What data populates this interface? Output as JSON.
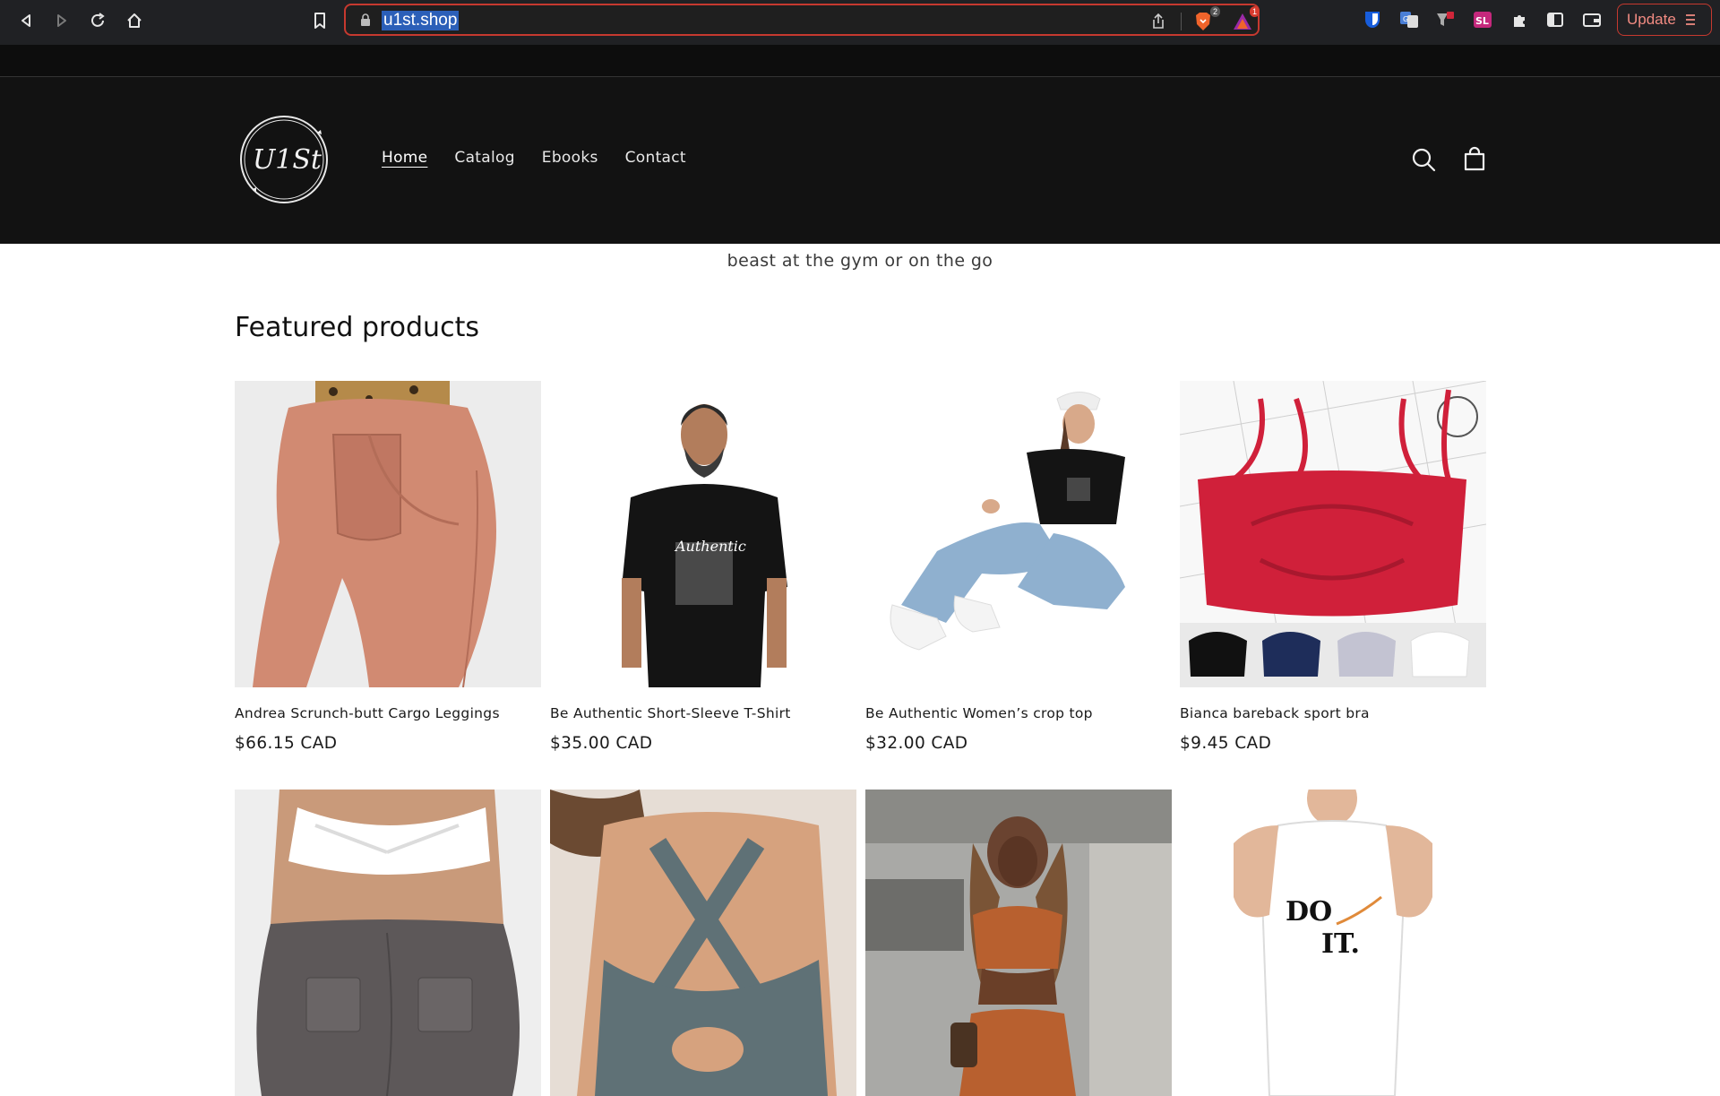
{
  "browser": {
    "url": "u1st.shop",
    "shields_badge": "2",
    "alert_badge": "1",
    "update_label": "Update",
    "accent_color": "#c6392f"
  },
  "store": {
    "logo_text": "U1St",
    "nav": [
      {
        "label": "Home",
        "active": true
      },
      {
        "label": "Catalog",
        "active": false
      },
      {
        "label": "Ebooks",
        "active": false
      },
      {
        "label": "Contact",
        "active": false
      }
    ],
    "header_icons": [
      "search-icon",
      "cart-icon"
    ],
    "header_bg": "#121212"
  },
  "main": {
    "tagline": "beast at the gym or on the go",
    "featured_title": "Featured products",
    "products": [
      {
        "title": "Andrea Scrunch-butt Cargo Leggings",
        "price": "$66.15 CAD"
      },
      {
        "title": "Be Authentic Short-Sleeve T-Shirt",
        "price": "$35.00 CAD"
      },
      {
        "title": "Be Authentic Women’s crop top",
        "price": "$32.00 CAD"
      },
      {
        "title": "Bianca bareback sport bra",
        "price": "$9.45 CAD"
      }
    ],
    "tshirt_print": "Authentic",
    "tank_print_1": "DO",
    "tank_print_2": "IT."
  }
}
